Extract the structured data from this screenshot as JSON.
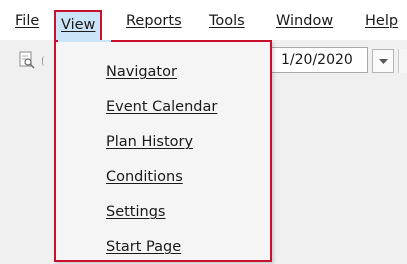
{
  "menubar": {
    "items": [
      {
        "label": "File"
      },
      {
        "label": "View"
      },
      {
        "label": "Reports"
      },
      {
        "label": "Tools"
      },
      {
        "label": "Window"
      },
      {
        "label": "Help"
      }
    ]
  },
  "toolbar": {
    "date_value": "1/20/2020"
  },
  "view_menu": {
    "items": [
      {
        "label": "Navigator"
      },
      {
        "label": "Event Calendar"
      },
      {
        "label": "Plan History"
      },
      {
        "label": "Conditions"
      },
      {
        "label": "Settings"
      },
      {
        "label": "Start Page"
      }
    ]
  },
  "colors": {
    "highlight_border": "#c8102e",
    "active_menu_bg": "#cce4f7"
  }
}
